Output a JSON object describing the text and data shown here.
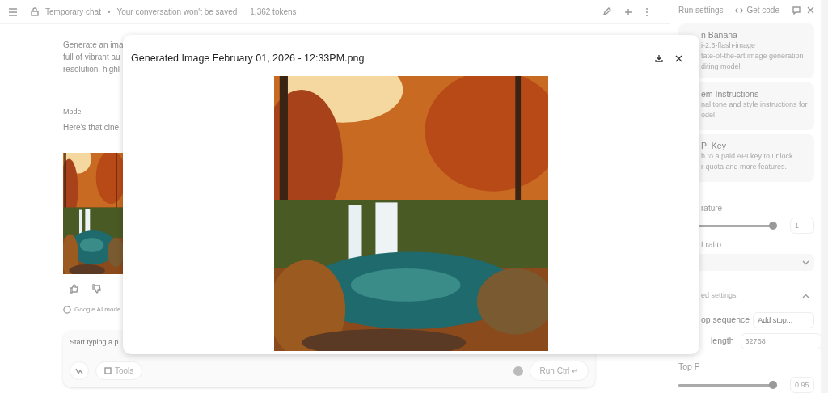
{
  "topbar": {
    "title": "Temporary chat",
    "separator": "•",
    "notice": "Your conversation won't be saved",
    "tokens": "1,362 tokens"
  },
  "chat": {
    "prompt_lines": [
      "Generate an ima",
      "full of vibrant au",
      "resolution, highl"
    ],
    "model_label": "Model",
    "response": "Here's that cine",
    "disclaimer": "Google AI mode"
  },
  "composer": {
    "placeholder": "Start typing a p",
    "tools": "Tools",
    "run": "Run Ctrl ↵"
  },
  "run_settings": {
    "title": "Run settings",
    "get_code": "Get code",
    "cards": [
      {
        "title": "n Banana",
        "lines": [
          "i-2.5-flash-image",
          "tate-of-the-art image generation",
          "diting model."
        ]
      },
      {
        "title": "em Instructions",
        "lines": [
          "nal tone and style instructions for",
          "odel"
        ]
      },
      {
        "title": "PI Key",
        "lines": [
          "h to a paid API key to unlock",
          "r quota and more features."
        ]
      }
    ],
    "temperature": {
      "label": "rature",
      "level": 1,
      "value": "1"
    },
    "aspect_ratio": {
      "label": "t ratio"
    },
    "advanced": {
      "label": "ed settings",
      "expanded": true
    },
    "stop_sequence": {
      "label": "op sequence",
      "placeholder": "Add stop..."
    },
    "output_length": {
      "label": "length",
      "value": "32768"
    },
    "top_p": {
      "label": "Top P",
      "level": 1,
      "value": "0.95"
    }
  },
  "dialog": {
    "title": "Generated Image February 01, 2026 - 12:33PM.png"
  }
}
